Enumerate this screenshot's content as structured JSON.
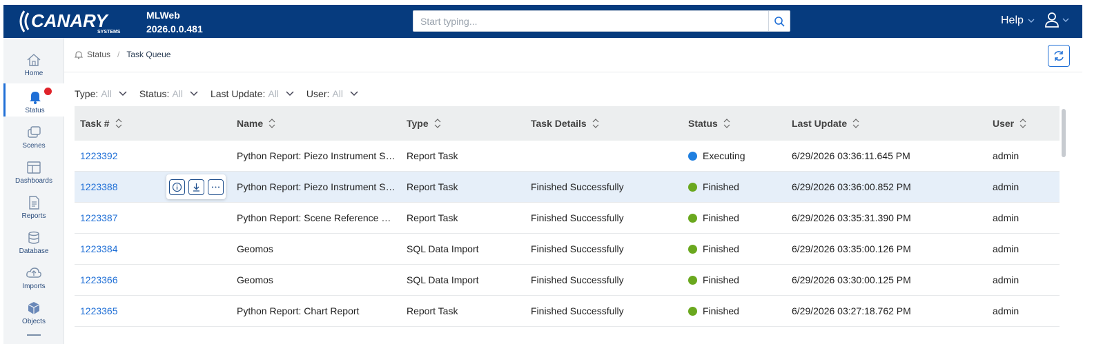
{
  "header": {
    "logo_text": "CANARY",
    "logo_sub": "SYSTEMS",
    "app_name": "MLWeb",
    "version": "2026.0.0.481",
    "search_placeholder": "Start typing...",
    "help_label": "Help",
    "bg_color": "#063b7e"
  },
  "sidebar": {
    "items": [
      {
        "label": "Home",
        "icon": "home-icon"
      },
      {
        "label": "Status",
        "icon": "bell-icon",
        "active": true
      },
      {
        "label": "Scenes",
        "icon": "scenes-icon"
      },
      {
        "label": "Dashboards",
        "icon": "dashboard-icon"
      },
      {
        "label": "Reports",
        "icon": "report-icon"
      },
      {
        "label": "Database",
        "icon": "database-icon"
      },
      {
        "label": "Imports",
        "icon": "cloud-upload-icon"
      },
      {
        "label": "Objects",
        "icon": "cube-icon"
      }
    ]
  },
  "breadcrumb": {
    "parent": "Status",
    "current": "Task Queue"
  },
  "filters": [
    {
      "label": "Type:",
      "value": "All"
    },
    {
      "label": "Status:",
      "value": "All"
    },
    {
      "label": "Last Update:",
      "value": "All"
    },
    {
      "label": "User:",
      "value": "All"
    }
  ],
  "table": {
    "columns": [
      "Task #",
      "Name",
      "Type",
      "Task Details",
      "Status",
      "Last Update",
      "User"
    ],
    "rows": [
      {
        "task": "1223392",
        "name": "Python Report: Piezo Instrument St...",
        "type": "Report Task",
        "details": "",
        "status": "Executing",
        "status_color": "#1f7fe0",
        "updated": "6/29/2026 03:36:11.645 PM",
        "user": "admin"
      },
      {
        "task": "1223388",
        "name": "Python Report: Piezo Instrument St...",
        "type": "Report Task",
        "details": "Finished Successfully",
        "status": "Finished",
        "status_color": "#6aa81e",
        "updated": "6/29/2026 03:36:00.852 PM",
        "user": "admin"
      },
      {
        "task": "1223387",
        "name": "Python Report: Scene Reference Re...",
        "type": "Report Task",
        "details": "Finished Successfully",
        "status": "Finished",
        "status_color": "#6aa81e",
        "updated": "6/29/2026 03:35:31.390 PM",
        "user": "admin"
      },
      {
        "task": "1223384",
        "name": "Geomos",
        "type": "SQL Data Import",
        "details": "Finished Successfully",
        "status": "Finished",
        "status_color": "#6aa81e",
        "updated": "6/29/2026 03:35:00.126 PM",
        "user": "admin"
      },
      {
        "task": "1223366",
        "name": "Geomos",
        "type": "SQL Data Import",
        "details": "Finished Successfully",
        "status": "Finished",
        "status_color": "#6aa81e",
        "updated": "6/29/2026 03:30:00.125 PM",
        "user": "admin"
      },
      {
        "task": "1223365",
        "name": "Python Report: Chart Report",
        "type": "Report Task",
        "details": "Finished Successfully",
        "status": "Finished",
        "status_color": "#6aa81e",
        "updated": "6/29/2026 03:27:18.762 PM",
        "user": "admin"
      }
    ]
  }
}
